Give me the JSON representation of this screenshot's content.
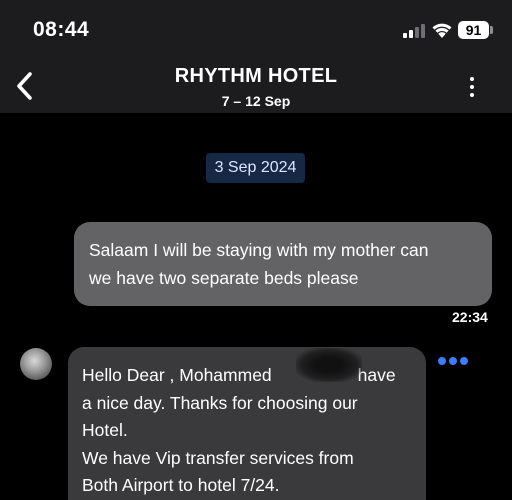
{
  "status_bar": {
    "time": "08:44",
    "battery": "91"
  },
  "header": {
    "title": "RHYTHM HOTEL",
    "subtitle": "7 – 12 Sep"
  },
  "conversation": {
    "date_separator": "3 Sep 2024",
    "messages": [
      {
        "direction": "outgoing",
        "lines": [
          "Salaam I will be staying with my mother can",
          "we have two separate beds please"
        ],
        "time": "22:34"
      },
      {
        "direction": "incoming",
        "lines": [
          "Hello Dear , Mohammed",
          "have",
          "a nice day. Thanks for choosing our",
          "Hotel.",
          "We have Vip transfer services from",
          "Both Airport to hotel 7/24."
        ]
      }
    ]
  },
  "colors": {
    "header_bg": "#1c1c1e",
    "outgoing_bubble": "#636366",
    "incoming_bubble": "#3a3a3c",
    "date_pill_bg": "#172845",
    "accent_blue": "#3d7cff"
  }
}
